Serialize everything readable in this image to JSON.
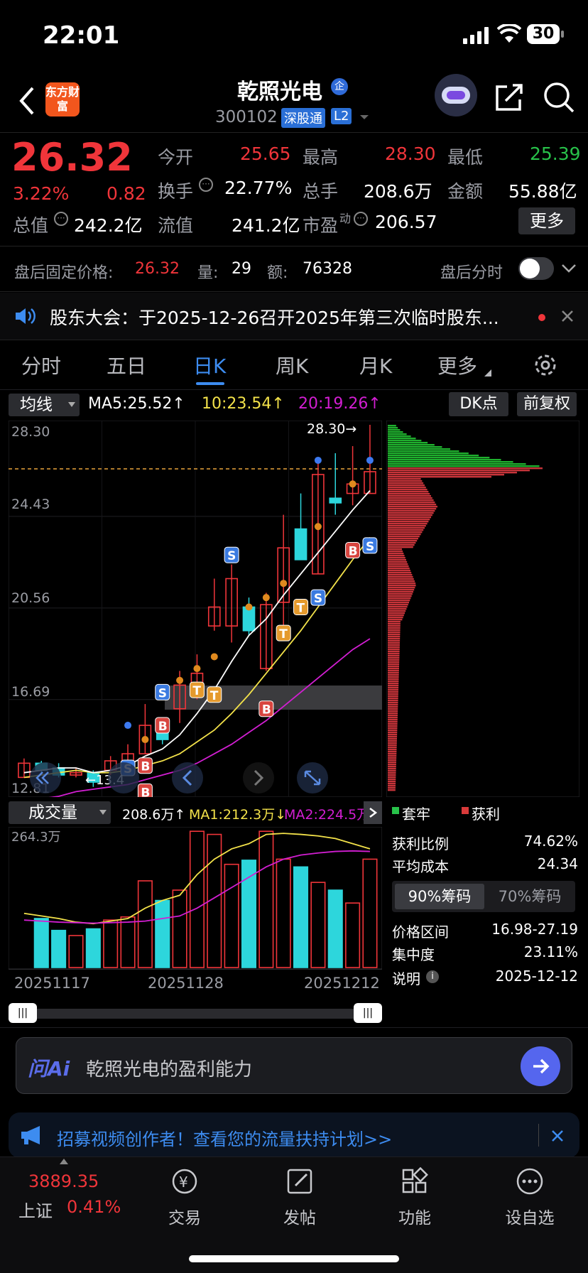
{
  "status_bar": {
    "time": "22:01",
    "battery": "30"
  },
  "header": {
    "title": "乾照光电",
    "badge": "企",
    "code": "300102",
    "tag1": "深股通",
    "tag2": "L2",
    "logo": "东方财富"
  },
  "quote": {
    "price": "26.32",
    "change_pct": "3.22%",
    "change": "0.82",
    "open_label": "今开",
    "open": "25.65",
    "high_label": "最高",
    "high": "28.30",
    "low_label": "最低",
    "low": "25.39",
    "turnover_label": "换手",
    "turnover": "22.77%",
    "volume_label": "总手",
    "volume": "208.6万",
    "amount_label": "金额",
    "amount": "55.88亿",
    "total_cap_label": "总值",
    "total_cap": "242.2亿",
    "float_cap_label": "流值",
    "float_cap": "241.2亿",
    "pe_label": "市盈",
    "pe_sup": "动",
    "pe": "206.57",
    "more_label": "更多"
  },
  "after_hours": {
    "label": "盘后固定价格:",
    "price": "26.32",
    "qty_label": "量:",
    "qty": "29",
    "amt_label": "额:",
    "amt": "76328",
    "toggle_label": "盘后分时"
  },
  "notice": {
    "text": "股东大会：于2025-12-26召开2025年第三次临时股东..."
  },
  "tabs": [
    "分时",
    "五日",
    "日K",
    "周K",
    "月K",
    "更多"
  ],
  "active_tab": "日K",
  "ma_bar": {
    "selector": "均线",
    "ma5": "MA5:25.52↑",
    "ma10": "10:23.54↑",
    "ma20": "20:19.26↑",
    "dk": "DK点",
    "adjust": "前复权"
  },
  "chart": {
    "y_labels": [
      "28.30",
      "24.43",
      "20.56",
      "16.69",
      "12.81"
    ],
    "high_marker": "28.30→",
    "low_marker": "←13.4",
    "colors": {
      "up": "#f0353a",
      "down": "#2dd6dc",
      "ma5": "#ffffff",
      "ma10": "#f3e24a",
      "ma20": "#d21ed2"
    }
  },
  "chart_data": {
    "type": "candlestick",
    "candles": [
      {
        "o": 13.4,
        "c": 14.0,
        "h": 14.2,
        "l": 13.4
      },
      {
        "o": 14.0,
        "c": 13.7,
        "h": 14.1,
        "l": 13.5
      },
      {
        "o": 13.8,
        "c": 13.5,
        "h": 14.0,
        "l": 13.4
      },
      {
        "o": 13.5,
        "c": 13.6,
        "h": 13.8,
        "l": 13.4
      },
      {
        "o": 13.6,
        "c": 13.2,
        "h": 13.7,
        "l": 13.0
      },
      {
        "o": 13.7,
        "c": 14.1,
        "h": 14.3,
        "l": 13.5
      },
      {
        "o": 14.1,
        "c": 14.4,
        "h": 14.8,
        "l": 13.9
      },
      {
        "o": 14.4,
        "c": 15.6,
        "h": 16.5,
        "l": 14.4
      },
      {
        "o": 15.5,
        "c": 15.0,
        "h": 15.6,
        "l": 14.8
      },
      {
        "o": 16.3,
        "c": 17.3,
        "h": 17.9,
        "l": 15.7
      },
      {
        "o": 16.9,
        "c": 17.8,
        "h": 18.6,
        "l": 16.7
      },
      {
        "o": 19.8,
        "c": 20.6,
        "h": 21.8,
        "l": 19.6
      },
      {
        "o": 19.8,
        "c": 21.8,
        "h": 22.4,
        "l": 19.1
      },
      {
        "o": 20.6,
        "c": 19.6,
        "h": 21.0,
        "l": 19.4
      },
      {
        "o": 18.0,
        "c": 20.7,
        "h": 21.2,
        "l": 17.9
      },
      {
        "o": 20.8,
        "c": 23.1,
        "h": 24.5,
        "l": 19.8
      },
      {
        "o": 23.9,
        "c": 22.6,
        "h": 25.4,
        "l": 22.6
      },
      {
        "o": 22.0,
        "c": 26.2,
        "h": 26.9,
        "l": 22.0
      },
      {
        "o": 25.2,
        "c": 25.0,
        "h": 27.1,
        "l": 24.5
      },
      {
        "o": 25.4,
        "c": 25.8,
        "h": 27.4,
        "l": 24.9
      },
      {
        "o": 25.4,
        "c": 26.32,
        "h": 28.3,
        "l": 25.39
      }
    ],
    "ma5": [
      13.6,
      13.7,
      13.8,
      13.8,
      13.6,
      13.7,
      13.9,
      14.3,
      14.6,
      15.2,
      16.1,
      17.1,
      18.3,
      19.4,
      20.1,
      21.1,
      22.0,
      22.9,
      23.8,
      24.7,
      25.52
    ],
    "ma10": [
      13.4,
      13.5,
      13.6,
      13.7,
      13.6,
      13.6,
      13.7,
      13.9,
      14.1,
      14.4,
      14.9,
      15.4,
      16.1,
      16.9,
      17.8,
      18.7,
      19.6,
      20.6,
      21.6,
      22.6,
      23.54
    ],
    "ma20": [
      12.4,
      12.5,
      12.6,
      12.8,
      12.9,
      13.0,
      13.1,
      13.3,
      13.5,
      13.7,
      14.0,
      14.4,
      14.8,
      15.3,
      15.8,
      16.4,
      17.0,
      17.6,
      18.2,
      18.8,
      19.26
    ],
    "volume": [
      0,
      95,
      72,
      62,
      75,
      92,
      98,
      168,
      130,
      150,
      264,
      258,
      200,
      208,
      264,
      210,
      195,
      165,
      150,
      125,
      210
    ],
    "vol_ma1": [
      105,
      100,
      95,
      88,
      85,
      90,
      95,
      115,
      130,
      140,
      180,
      210,
      230,
      240,
      258,
      260,
      258,
      255,
      250,
      240,
      230
    ],
    "vol_ma2": [
      92,
      90,
      88,
      87,
      86,
      87,
      88,
      90,
      95,
      100,
      115,
      135,
      155,
      175,
      195,
      210,
      218,
      222,
      225,
      226,
      225
    ]
  },
  "volume": {
    "selector": "成交量",
    "value": "208.6万↑",
    "ma1": "MA1:212.3万↓",
    "ma2": "MA2:224.5万",
    "y_top": "264.3万",
    "x_labels": [
      "20251117",
      "20251128",
      "20251212"
    ]
  },
  "chip": {
    "legend_trap": "套牢",
    "legend_profit": "获利",
    "rows": [
      {
        "label": "获利比例",
        "value": "74.62%"
      },
      {
        "label": "平均成本",
        "value": "24.34"
      }
    ],
    "tab90": "90%筹码",
    "tab70": "70%筹码",
    "rows2": [
      {
        "label": "价格区间",
        "value": "16.98-27.19"
      },
      {
        "label": "集中度",
        "value": "23.11%"
      },
      {
        "label": "说明",
        "value": "2025-12-12"
      }
    ]
  },
  "ai": {
    "brand": "问Ai",
    "prompt": "乾照光电的盈利能力"
  },
  "banner": {
    "text": "招募视频创作者！查看您的流量扶持计划>>"
  },
  "bottom_nav": {
    "index_value": "3889.35",
    "index_name": "上证",
    "index_pct": "0.41%",
    "items": [
      "交易",
      "发帖",
      "功能",
      "设自选"
    ]
  }
}
